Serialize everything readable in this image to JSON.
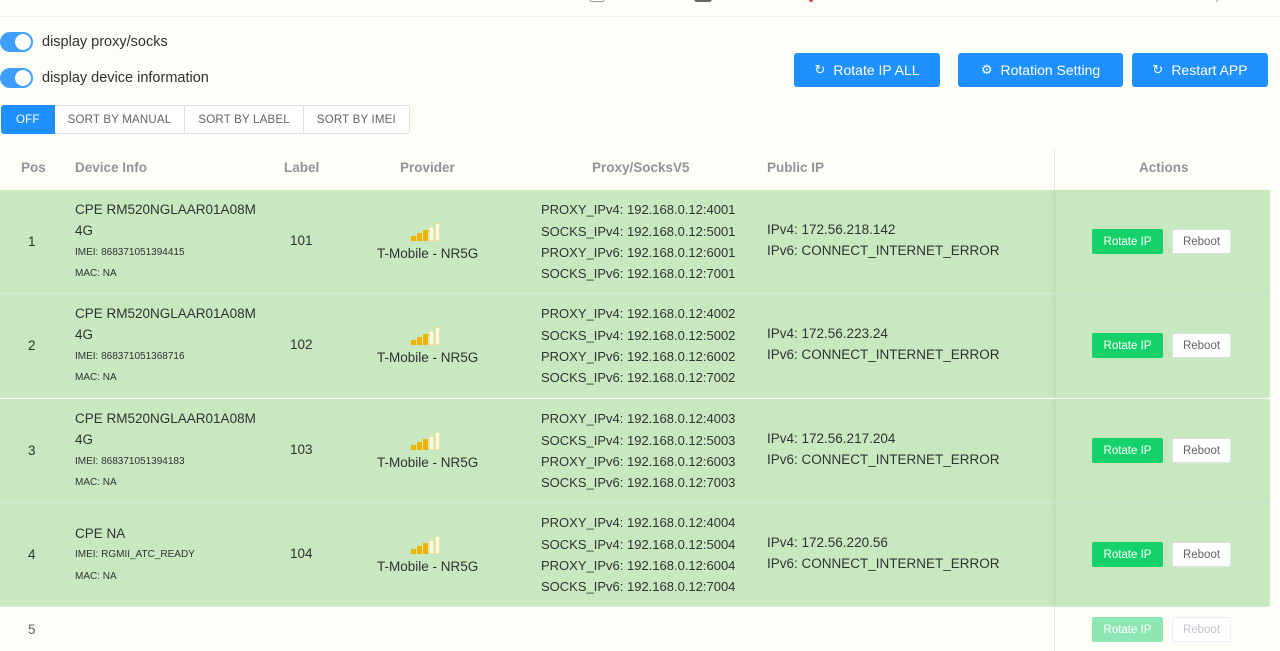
{
  "toggles": {
    "proxy": {
      "label": "display proxy/socks",
      "on": true
    },
    "device": {
      "label": "display device information",
      "on": true
    }
  },
  "top_buttons": {
    "rotate_all": "Rotate IP ALL",
    "rotation_setting": "Rotation Setting",
    "restart_app": "Restart APP"
  },
  "sort_tabs": [
    "OFF",
    "SORT BY MANUAL",
    "SORT BY LABEL",
    "SORT BY IMEI"
  ],
  "columns": {
    "pos": "Pos",
    "device": "Device Info",
    "label": "Label",
    "provider": "Provider",
    "proxy": "Proxy/SocksV5",
    "public_ip": "Public IP",
    "actions": "Actions"
  },
  "colors": {
    "accent": "#1e90ff",
    "row_bg": "#c8e9c0",
    "rotate_green": "#14d16a",
    "signal_on": "#f0b400",
    "signal_off": "#f3e3a0"
  },
  "rows": [
    {
      "pos": "1",
      "device_title": "CPE RM520NGLAAR01A08M4G",
      "imei": "IMEI: 868371051394415",
      "mac": "MAC: NA",
      "label": "101",
      "provider": "T-Mobile - NR5G",
      "signal_level": 0.6,
      "proxy": [
        "PROXY_IPv4: 192.168.0.12:4001",
        "SOCKS_IPv4: 192.168.0.12:5001",
        "PROXY_IPv6: 192.168.0.12:6001",
        "SOCKS_IPv6: 192.168.0.12:7001"
      ],
      "ipv4": "IPv4: 172.56.218.142",
      "ipv6": "IPv6: CONNECT_INTERNET_ERROR",
      "rotate": "Rotate IP",
      "reboot": "Reboot"
    },
    {
      "pos": "2",
      "device_title": "CPE RM520NGLAAR01A08M4G",
      "imei": "IMEI: 868371051368716",
      "mac": "MAC: NA",
      "label": "102",
      "provider": "T-Mobile - NR5G",
      "signal_level": 0.6,
      "proxy": [
        "PROXY_IPv4: 192.168.0.12:4002",
        "SOCKS_IPv4: 192.168.0.12:5002",
        "PROXY_IPv6: 192.168.0.12:6002",
        "SOCKS_IPv6: 192.168.0.12:7002"
      ],
      "ipv4": "IPv4: 172.56.223.24",
      "ipv6": "IPv6: CONNECT_INTERNET_ERROR",
      "rotate": "Rotate IP",
      "reboot": "Reboot"
    },
    {
      "pos": "3",
      "device_title": "CPE RM520NGLAAR01A08M4G",
      "imei": "IMEI: 868371051394183",
      "mac": "MAC: NA",
      "label": "103",
      "provider": "T-Mobile - NR5G",
      "signal_level": 0.6,
      "proxy": [
        "PROXY_IPv4: 192.168.0.12:4003",
        "SOCKS_IPv4: 192.168.0.12:5003",
        "PROXY_IPv6: 192.168.0.12:6003",
        "SOCKS_IPv6: 192.168.0.12:7003"
      ],
      "ipv4": "IPv4: 172.56.217.204",
      "ipv6": "IPv6: CONNECT_INTERNET_ERROR",
      "rotate": "Rotate IP",
      "reboot": "Reboot"
    },
    {
      "pos": "4",
      "device_title": "CPE NA",
      "imei": "IMEI: RGMII_ATC_READY",
      "mac": "MAC: NA",
      "label": "104",
      "provider": "T-Mobile - NR5G",
      "signal_level": 0.6,
      "proxy": [
        "PROXY_IPv4: 192.168.0.12:4004",
        "SOCKS_IPv4: 192.168.0.12:5004",
        "PROXY_IPv6: 192.168.0.12:6004",
        "SOCKS_IPv6: 192.168.0.12:7004"
      ],
      "ipv4": "IPv4: 172.56.220.56",
      "ipv6": "IPv6: CONNECT_INTERNET_ERROR",
      "rotate": "Rotate IP",
      "reboot": "Reboot"
    }
  ],
  "row5": {
    "pos": "5",
    "rotate": "Rotate IP",
    "reboot": "Reboot"
  }
}
